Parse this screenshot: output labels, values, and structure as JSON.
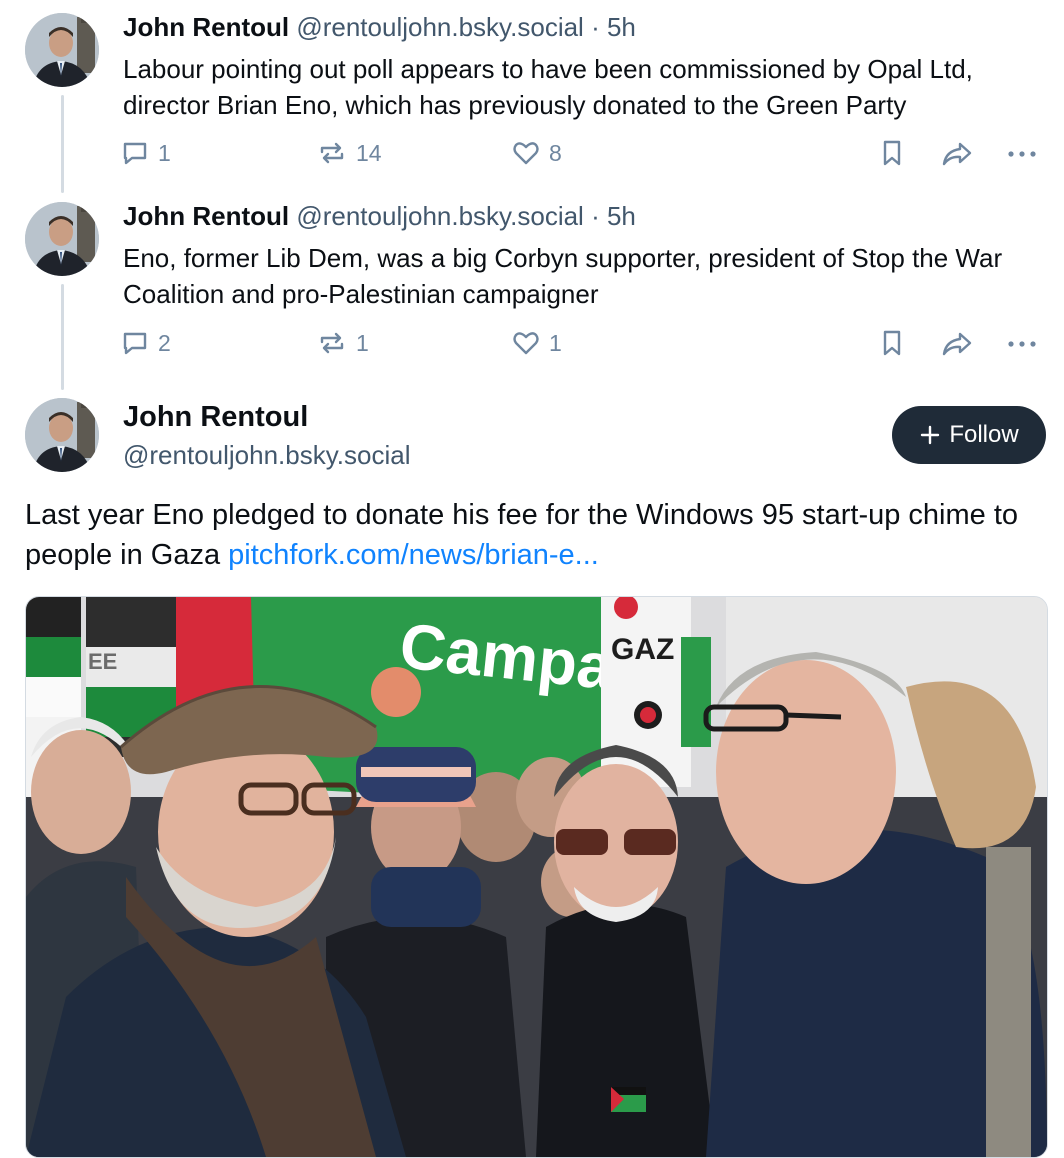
{
  "posts": [
    {
      "author": "John Rentoul",
      "handle": "@rentouljohn.bsky.social",
      "separator": "·",
      "time": "5h",
      "text": "Labour pointing out poll appears to have been commissioned by Opal Ltd, director Brian Eno, which has previously donated to the Green Party",
      "replies": "1",
      "reposts": "14",
      "likes": "8"
    },
    {
      "author": "John Rentoul",
      "handle": "@rentouljohn.bsky.social",
      "separator": "·",
      "time": "5h",
      "text": "Eno, former Lib Dem, was a big Corbyn supporter, president of Stop the War Coalition and pro-Palestinian campaigner",
      "replies": "2",
      "reposts": "1",
      "likes": "1"
    }
  ],
  "main_post": {
    "author": "John Rentoul",
    "handle": "@rentouljohn.bsky.social",
    "follow_label": "Follow",
    "follow_icon": "plus-icon",
    "text": "Last year Eno pledged to donate his fee for the Windows 95 start-up chime to people in Gaza ",
    "link_text": "pitchfork.com/news/brian-e...",
    "embed_image": {
      "banner_text": "Campai",
      "sign_text": "GAZ",
      "flag_text": "EE"
    }
  },
  "colors": {
    "text": "#0b0f14",
    "muted": "#42576c",
    "icon": "#6f869f",
    "link": "#1083fe",
    "follow_bg": "#1f2b38",
    "thread_line": "#d4dbe2"
  }
}
